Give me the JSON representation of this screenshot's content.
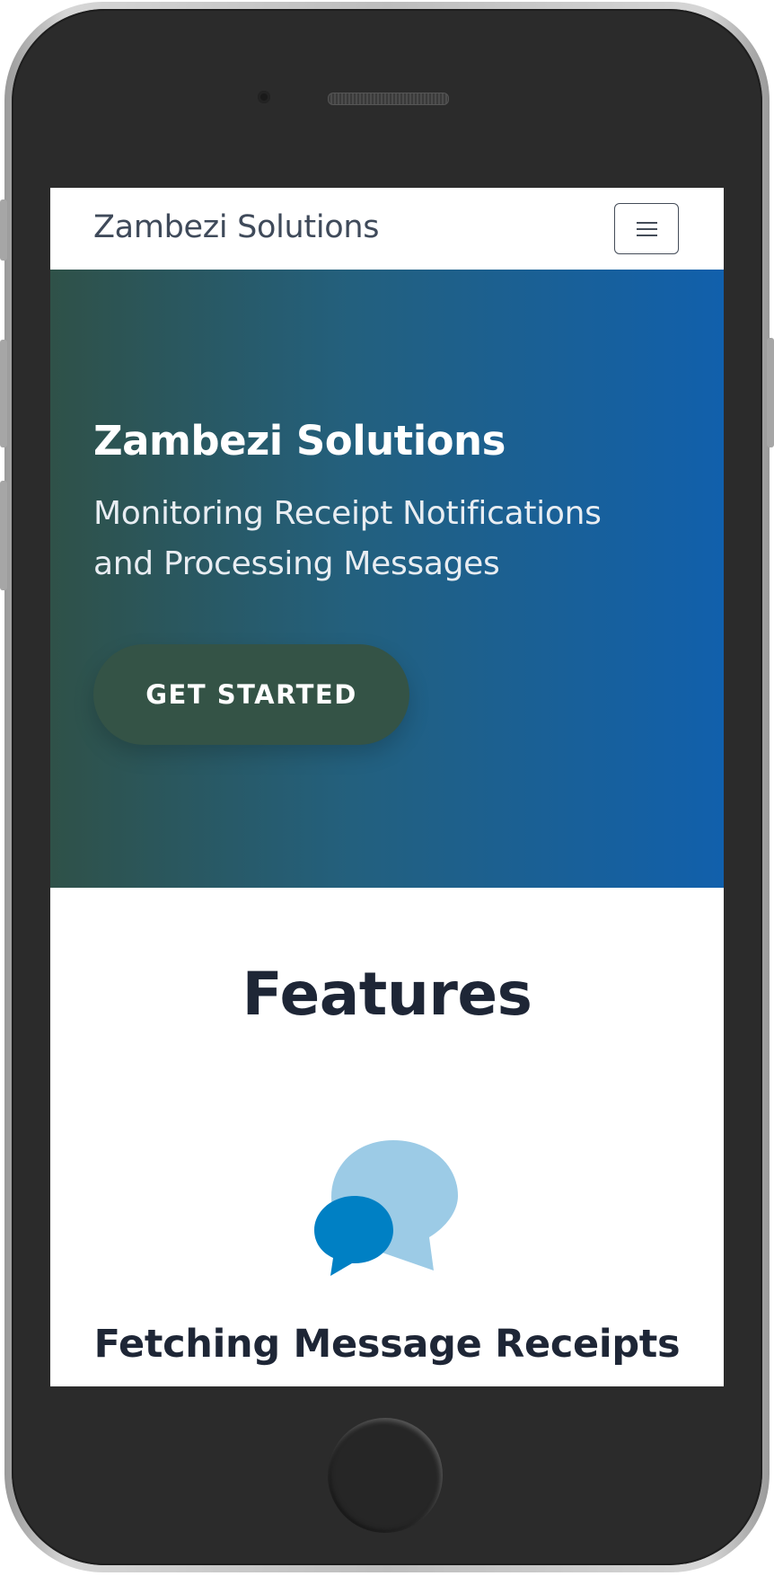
{
  "navbar": {
    "brand": "Zambezi Solutions",
    "toggler_icon": "hamburger-menu-icon"
  },
  "hero": {
    "title": "Zambezi Solutions",
    "subtitle": "Monitoring Receipt Notifications and Processing Messages",
    "cta_label": "GET STARTED"
  },
  "features": {
    "title": "Features",
    "items": [
      {
        "icon": "chat-bubbles-icon",
        "heading": "Fetching Message Receipts"
      }
    ]
  },
  "colors": {
    "hero_gradient_start": "#2f5148",
    "hero_gradient_end": "#1160ac",
    "cta_background": "#345346",
    "heading_text": "#1e2636",
    "icon_light_blue": "#9ccbe6",
    "icon_dark_blue": "#0080c4"
  }
}
